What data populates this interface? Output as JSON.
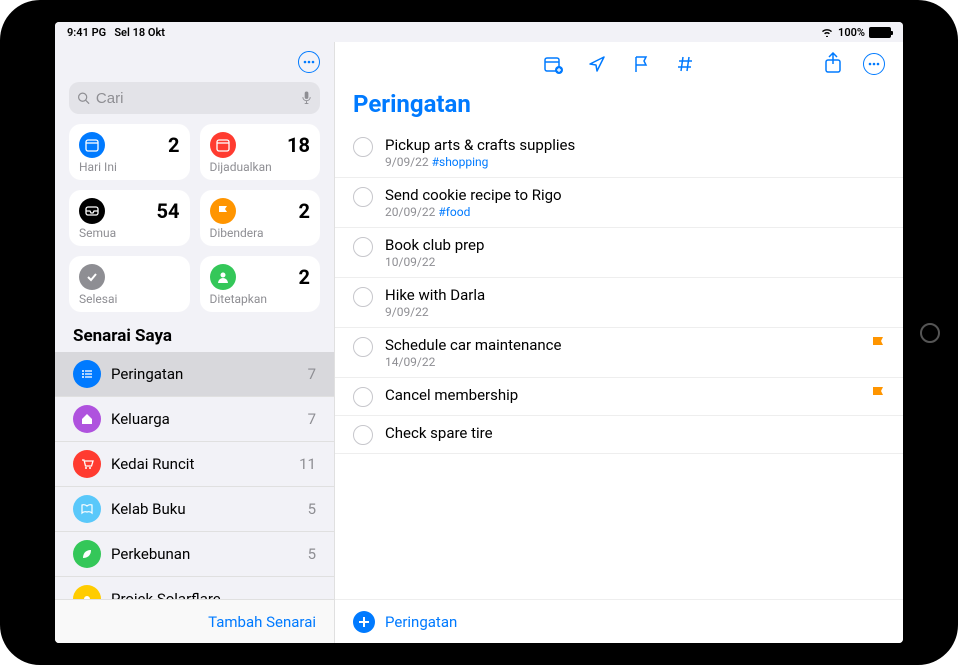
{
  "status": {
    "time": "9:41 PG",
    "date": "Sel 18 Okt",
    "battery_pct": "100%"
  },
  "sidebar": {
    "search_placeholder": "Cari",
    "smart_lists": [
      {
        "id": "today",
        "label": "Hari Ini",
        "count": "2",
        "color": "bg-blue",
        "glyph": "calendar"
      },
      {
        "id": "scheduled",
        "label": "Dijadualkan",
        "count": "18",
        "color": "bg-red",
        "glyph": "calendar"
      },
      {
        "id": "all",
        "label": "Semua",
        "count": "54",
        "color": "bg-black",
        "glyph": "inbox"
      },
      {
        "id": "flagged",
        "label": "Dibendera",
        "count": "2",
        "color": "bg-orange",
        "glyph": "flag"
      },
      {
        "id": "completed",
        "label": "Selesai",
        "count": "",
        "color": "bg-gray",
        "glyph": "check"
      },
      {
        "id": "assigned",
        "label": "Ditetapkan",
        "count": "2",
        "color": "bg-green",
        "glyph": "person"
      }
    ],
    "section_title": "Senarai Saya",
    "lists": [
      {
        "label": "Peringatan",
        "count": "7",
        "color": "bg-blue",
        "glyph": "list",
        "selected": true
      },
      {
        "label": "Keluarga",
        "count": "7",
        "color": "bg-purple",
        "glyph": "home",
        "selected": false
      },
      {
        "label": "Kedai Runcit",
        "count": "11",
        "color": "bg-red",
        "glyph": "cart",
        "selected": false
      },
      {
        "label": "Kelab Buku",
        "count": "5",
        "color": "bg-lightblue",
        "glyph": "book",
        "selected": false
      },
      {
        "label": "Perkebunan",
        "count": "5",
        "color": "bg-green",
        "glyph": "leaf",
        "selected": false
      },
      {
        "label": "Projek Solarflare",
        "count": "",
        "color": "bg-yellow",
        "glyph": "sun",
        "selected": false
      }
    ],
    "add_list_label": "Tambah Senarai"
  },
  "main": {
    "title": "Peringatan",
    "reminders": [
      {
        "title": "Pickup arts & crafts supplies",
        "date": "9/09/22",
        "tag": "#shopping",
        "flagged": false
      },
      {
        "title": "Send cookie recipe to Rigo",
        "date": "20/09/22",
        "tag": "#food",
        "flagged": false
      },
      {
        "title": "Book club prep",
        "date": "10/09/22",
        "tag": "",
        "flagged": false
      },
      {
        "title": "Hike with Darla",
        "date": "9/09/22",
        "tag": "",
        "flagged": false
      },
      {
        "title": "Schedule car maintenance",
        "date": "14/09/22",
        "tag": "",
        "flagged": true
      },
      {
        "title": "Cancel membership",
        "date": "",
        "tag": "",
        "flagged": true
      },
      {
        "title": "Check spare tire",
        "date": "",
        "tag": "",
        "flagged": false
      }
    ],
    "footer_label": "Peringatan"
  }
}
